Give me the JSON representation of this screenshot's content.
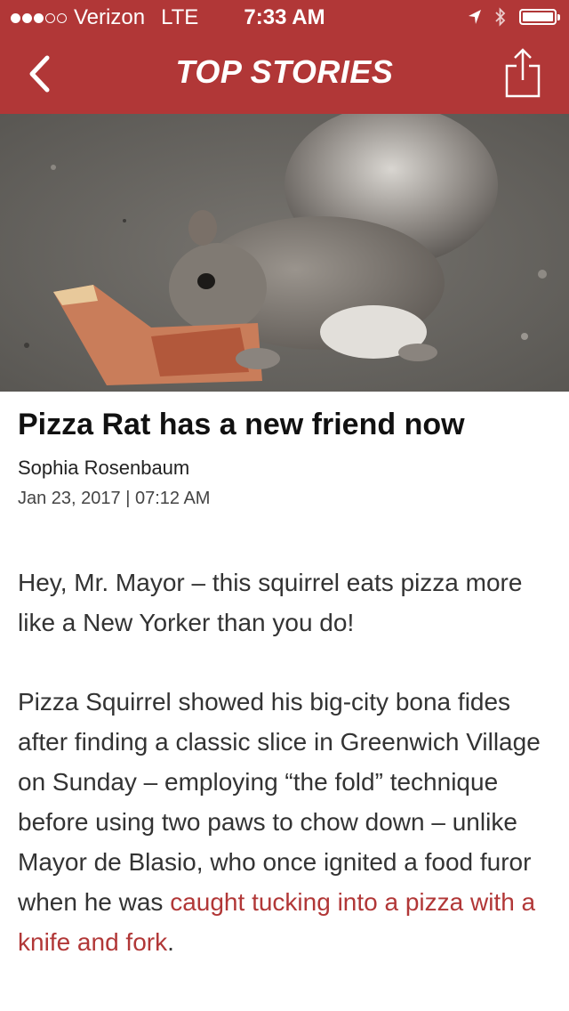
{
  "status_bar": {
    "carrier": "Verizon",
    "network": "LTE",
    "time": "7:33 AM",
    "signal_bars_filled": 3,
    "signal_bars_total": 5,
    "battery_level": 0.95
  },
  "nav": {
    "title": "TOP STORIES",
    "back_icon": "chevron-left-icon",
    "share_icon": "share-icon"
  },
  "colors": {
    "brand": "#b13737",
    "link": "#b13737"
  },
  "article": {
    "headline": "Pizza Rat has a new friend now",
    "author": "Sophia Rosenbaum",
    "date": "Jan 23, 2017 | 07:12 AM",
    "paragraph1": "Hey, Mr. Mayor – this squirrel eats pizza more like a New Yorker than you do!",
    "paragraph2_text": "Pizza Squirrel showed his big-city bona fides after finding a classic slice in Greenwich Village on Sunday – employing “the fold” technique before using two paws to chow down – unlike Mayor de Blasio, who once ignited a food furor when he was ",
    "paragraph2_link": "caught tucking into a pizza with a knife and fork",
    "paragraph2_end": "."
  }
}
